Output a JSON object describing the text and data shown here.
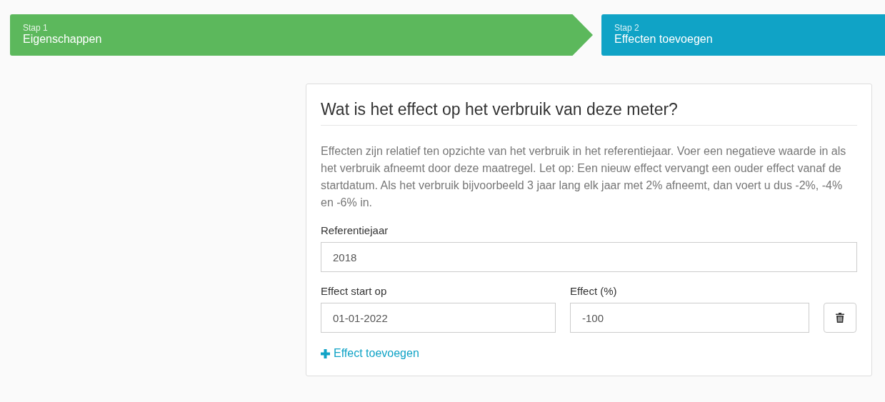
{
  "steps": [
    {
      "number": "Stap 1",
      "title": "Eigenschappen",
      "kind": "done"
    },
    {
      "number": "Stap 2",
      "title": "Effecten toevoegen",
      "kind": "active"
    }
  ],
  "card": {
    "title": "Wat is het effect op het verbruik van deze meter?",
    "description": "Effecten zijn relatief ten opzichte van het verbruik in het referentiejaar. Voer een negatieve waarde in als het verbruik afneemt door deze maatregel. Let op: Een nieuw effect vervangt een ouder effect vanaf de startdatum. Als het verbruik bijvoorbeeld 3 jaar lang elk jaar met 2% afneemt, dan voert u dus -2%, -4% en -6% in.",
    "reference_year": {
      "label": "Referentiejaar",
      "value": "2018"
    },
    "effect_columns": [
      "Effect start op",
      "Effect (%)"
    ],
    "effects": [
      {
        "start": "01-01-2022",
        "percent": "-100"
      }
    ],
    "add_link": "Effect toevoegen"
  }
}
